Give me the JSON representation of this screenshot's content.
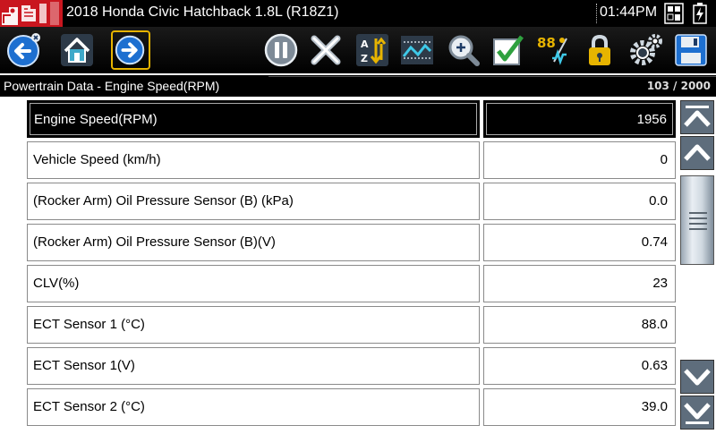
{
  "titlebar": {
    "title": "2018 Honda Civic Hatchback 1.8L (R18Z1)",
    "time": "01:44PM"
  },
  "toolbar": {
    "buttons": [
      {
        "name": "back-button",
        "icon": "back-arrow-icon"
      },
      {
        "name": "home-button",
        "icon": "home-icon"
      },
      {
        "name": "forward-button",
        "icon": "forward-arrow-icon",
        "selected": true
      },
      {
        "name": "pause-button",
        "icon": "pause-icon"
      },
      {
        "name": "clear-button",
        "icon": "close-icon"
      },
      {
        "name": "sort-button",
        "icon": "sort-az-icon"
      },
      {
        "name": "graph-view-button",
        "icon": "graph-icon"
      },
      {
        "name": "zoom-button",
        "icon": "zoom-icon"
      },
      {
        "name": "select-pids-button",
        "icon": "checkmark-icon"
      },
      {
        "name": "units-button",
        "icon": "units-icon",
        "label": "88"
      },
      {
        "name": "lock-button",
        "icon": "lock-icon"
      },
      {
        "name": "settings-button",
        "icon": "gear-icon"
      },
      {
        "name": "save-button",
        "icon": "save-icon"
      }
    ]
  },
  "header": {
    "title": "Powertrain Data - Engine Speed(RPM)",
    "count": "103 / 2000"
  },
  "rows": [
    {
      "name": "Engine Speed(RPM)",
      "value": "1956",
      "selected": true
    },
    {
      "name": "Vehicle Speed (km/h)",
      "value": "0"
    },
    {
      "name": "(Rocker Arm) Oil Pressure Sensor (B) (kPa)",
      "value": "0.0"
    },
    {
      "name": "(Rocker Arm) Oil Pressure Sensor (B)(V)",
      "value": "0.74"
    },
    {
      "name": "CLV(%)",
      "value": "23"
    },
    {
      "name": "ECT Sensor 1 (°C)",
      "value": "88.0"
    },
    {
      "name": "ECT Sensor 1(V)",
      "value": "0.63"
    },
    {
      "name": "ECT Sensor 2 (°C)",
      "value": "39.0"
    }
  ],
  "colors": {
    "accent_yellow": "#e7b400",
    "brand_red": "#d41a24",
    "icon_blue": "#1d6fd0"
  }
}
